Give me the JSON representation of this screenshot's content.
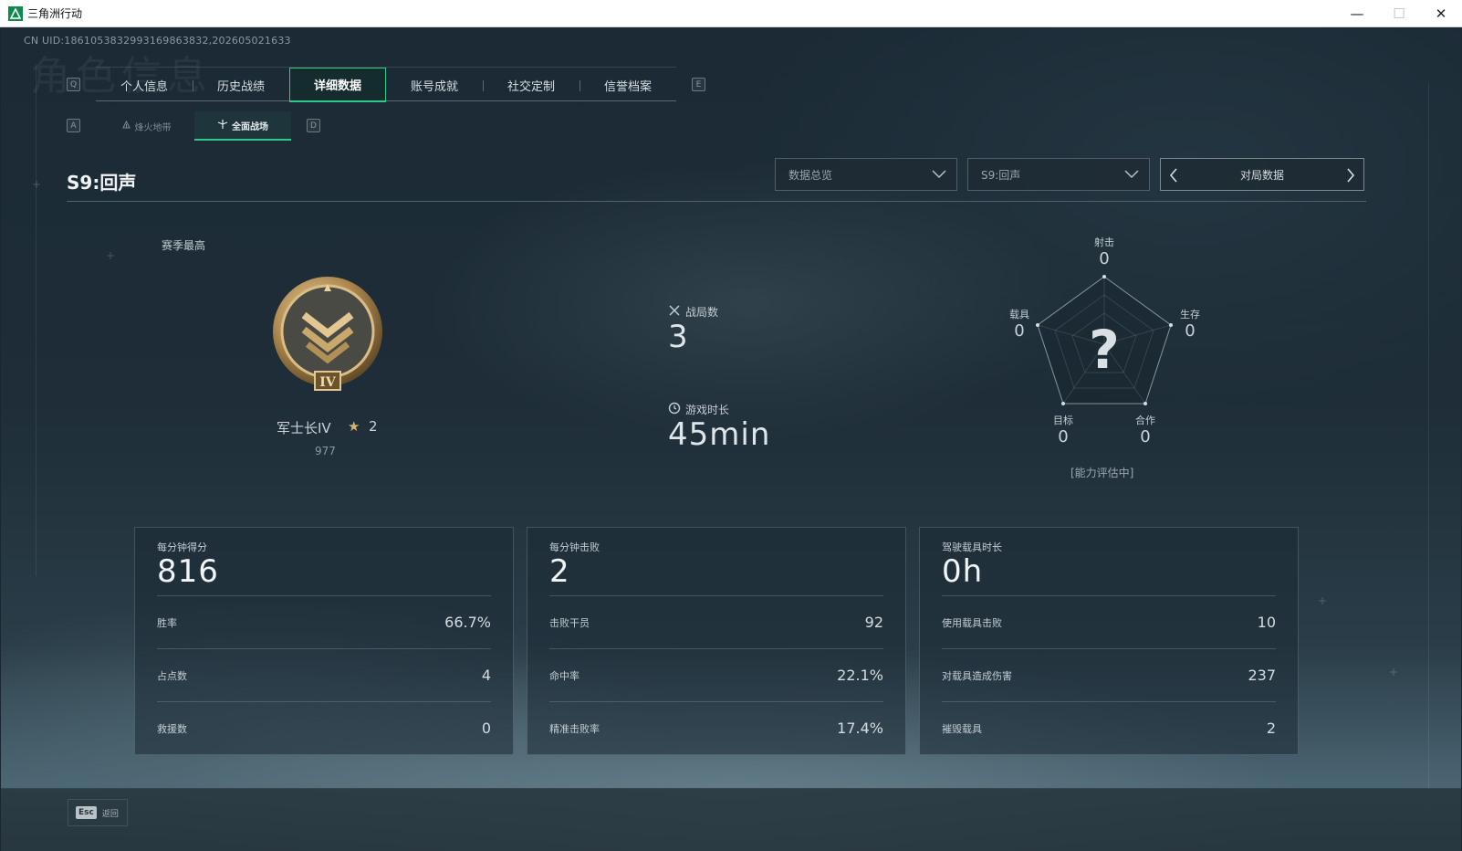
{
  "window": {
    "title": "三角洲行动",
    "minimize_glyph": "—",
    "maximize_glyph": "☐",
    "close_glyph": "✕"
  },
  "header": {
    "uid": "CN UID:1861053832993169863832,202605021633",
    "watermark": "角色信息"
  },
  "tabs": {
    "prev_key": "Q",
    "next_key": "E",
    "items": [
      {
        "label": "个人信息"
      },
      {
        "label": "历史战绩"
      },
      {
        "label": "详细数据"
      },
      {
        "label": "账号成就"
      },
      {
        "label": "社交定制"
      },
      {
        "label": "信誉档案"
      }
    ],
    "active_index": 2
  },
  "subtabs": {
    "prev_key": "A",
    "next_key": "D",
    "items": [
      {
        "label": "烽火地带",
        "icon": "fire-zone-icon"
      },
      {
        "label": "全面战场",
        "icon": "battlefield-icon"
      }
    ],
    "active_index": 1
  },
  "season": {
    "title": "S9:回声"
  },
  "filters": {
    "dropdown_scope": "数据总览",
    "dropdown_season": "S9:回声",
    "pager_label": "对局数据"
  },
  "rank": {
    "section_label": "赛季最高",
    "name": "军士长IV",
    "star_glyph": "★",
    "stars": "2",
    "score": "977",
    "badge_numeral": "IV"
  },
  "summary": {
    "matches_label": "战局数",
    "matches_value": "3",
    "playtime_label": "游戏时长",
    "playtime_value": "45min"
  },
  "radar": {
    "center_glyph": "?",
    "axes": [
      {
        "label": "射击",
        "value": "0"
      },
      {
        "label": "生存",
        "value": "0"
      },
      {
        "label": "合作",
        "value": "0"
      },
      {
        "label": "目标",
        "value": "0"
      },
      {
        "label": "载具",
        "value": "0"
      }
    ],
    "note": "[能力评估中]"
  },
  "panels": [
    {
      "title": "每分钟得分",
      "big": "816",
      "rows": [
        {
          "k": "胜率",
          "v": "66.7%"
        },
        {
          "k": "占点数",
          "v": "4"
        },
        {
          "k": "救援数",
          "v": "0"
        }
      ]
    },
    {
      "title": "每分钟击败",
      "big": "2",
      "rows": [
        {
          "k": "击败干员",
          "v": "92"
        },
        {
          "k": "命中率",
          "v": "22.1%"
        },
        {
          "k": "精准击败率",
          "v": "17.4%"
        }
      ]
    },
    {
      "title": "驾驶载具时长",
      "big": "0h",
      "rows": [
        {
          "k": "使用载具击败",
          "v": "10"
        },
        {
          "k": "对载具造成伤害",
          "v": "237"
        },
        {
          "k": "摧毁载具",
          "v": "2"
        }
      ]
    }
  ],
  "footer": {
    "esc_key": "Esc",
    "esc_label": "返回"
  },
  "colors": {
    "accent": "#2fc98a",
    "background": "#1e2d37",
    "gold": "#d7b56a"
  }
}
